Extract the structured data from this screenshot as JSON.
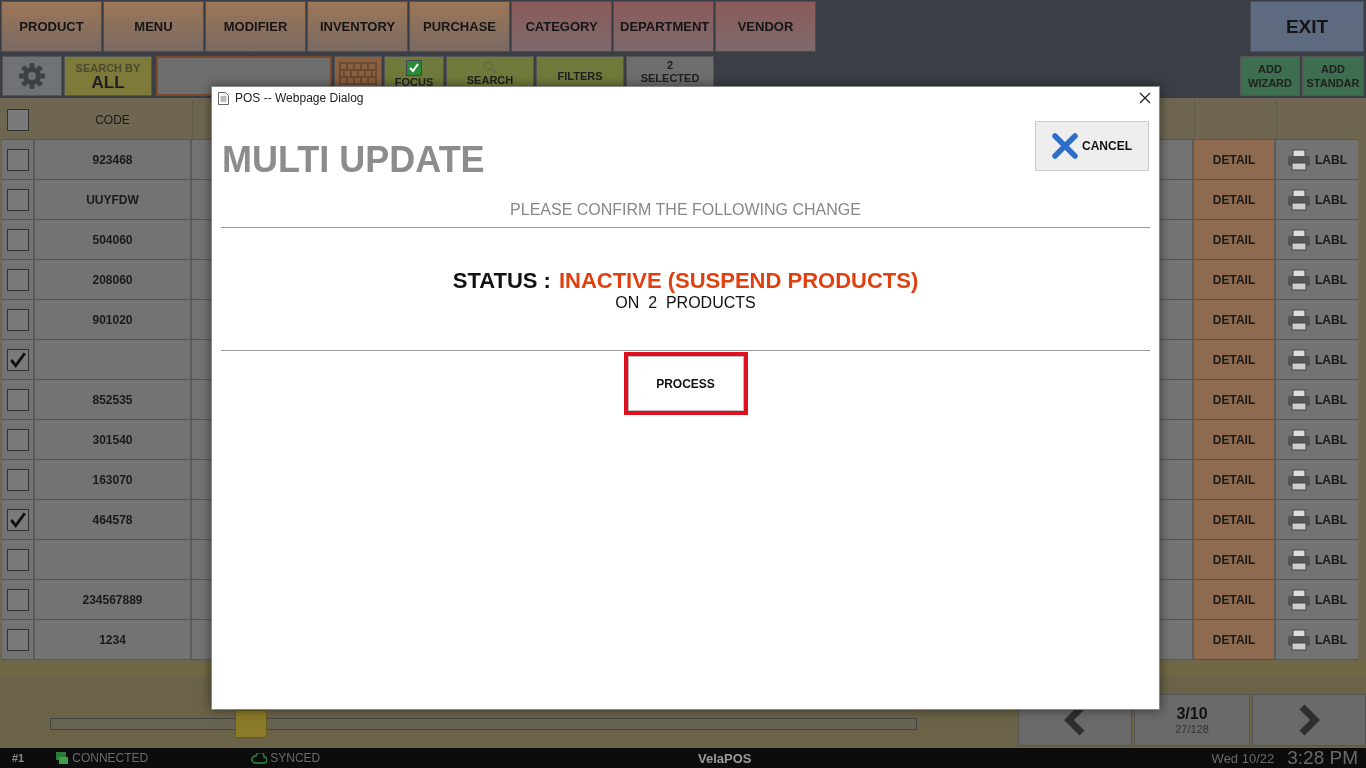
{
  "nav_tabs": [
    {
      "label": "PRODUCT",
      "kind": "main"
    },
    {
      "label": "MENU",
      "kind": "main"
    },
    {
      "label": "MODIFIER",
      "kind": "main"
    },
    {
      "label": "INVENTORY",
      "kind": "main"
    },
    {
      "label": "PURCHASE",
      "kind": "main"
    },
    {
      "label": "CATEGORY",
      "kind": "sub"
    },
    {
      "label": "DEPARTMENT",
      "kind": "sub"
    },
    {
      "label": "VENDOR",
      "kind": "sub"
    }
  ],
  "exit_button": "EXIT",
  "toolbar": {
    "search_by_label": "SEARCH BY",
    "search_by_value": "ALL",
    "focus": {
      "label": "FOCUS",
      "checked": true
    },
    "search_button": "SEARCH",
    "filters_button": "FILTERS",
    "selected_count": "2",
    "selected_label": "SELECTED",
    "add_wizard": "ADD WIZARD",
    "add_standard": "ADD STANDAR"
  },
  "table": {
    "all_checked": false,
    "columns": [
      {
        "label": "CODE"
      }
    ],
    "rows": [
      {
        "checked": false,
        "code": "923468",
        "detail": "DETAIL",
        "label_button": "LABL"
      },
      {
        "checked": false,
        "code": "UUYFDW",
        "detail": "DETAIL",
        "label_button": "LABL"
      },
      {
        "checked": false,
        "code": "504060",
        "detail": "DETAIL",
        "label_button": "LABL"
      },
      {
        "checked": false,
        "code": "208060",
        "detail": "DETAIL",
        "label_button": "LABL"
      },
      {
        "checked": false,
        "code": "901020",
        "detail": "DETAIL",
        "label_button": "LABL"
      },
      {
        "checked": true,
        "detail": "DETAIL",
        "label_button": "LABL"
      },
      {
        "checked": false,
        "code": "852535",
        "detail": "DETAIL",
        "label_button": "LABL"
      },
      {
        "checked": false,
        "code": "301540",
        "detail": "DETAIL",
        "label_button": "LABL"
      },
      {
        "checked": false,
        "code": "163070",
        "detail": "DETAIL",
        "label_button": "LABL"
      },
      {
        "checked": true,
        "code": "464578",
        "detail": "DETAIL",
        "label_button": "LABL"
      },
      {
        "checked": false,
        "detail": "DETAIL",
        "label_button": "LABL"
      },
      {
        "checked": false,
        "code": "234567889",
        "detail": "DETAIL",
        "label_button": "LABL"
      },
      {
        "checked": false,
        "code": "1234",
        "detail": "DETAIL",
        "label_button": "LABL"
      }
    ]
  },
  "pager": {
    "page": "3/10",
    "items": "27/128"
  },
  "status_bar": {
    "terminal": "#1",
    "connection": "CONNECTED",
    "sync": "SYNCED",
    "app_name": "VelaPOS",
    "date": "Wed 10/22",
    "time": "3:28 PM"
  },
  "dialog": {
    "title": "POS -- Webpage Dialog",
    "heading": "MULTI UPDATE",
    "cancel": "CANCEL",
    "prompt": "PLEASE CONFIRM THE FOLLOWING CHANGE",
    "change_label": "STATUS :",
    "change_value": "INACTIVE (SUSPEND PRODUCTS)",
    "scope": "ON  2  PRODUCTS",
    "process": "PROCESS"
  }
}
